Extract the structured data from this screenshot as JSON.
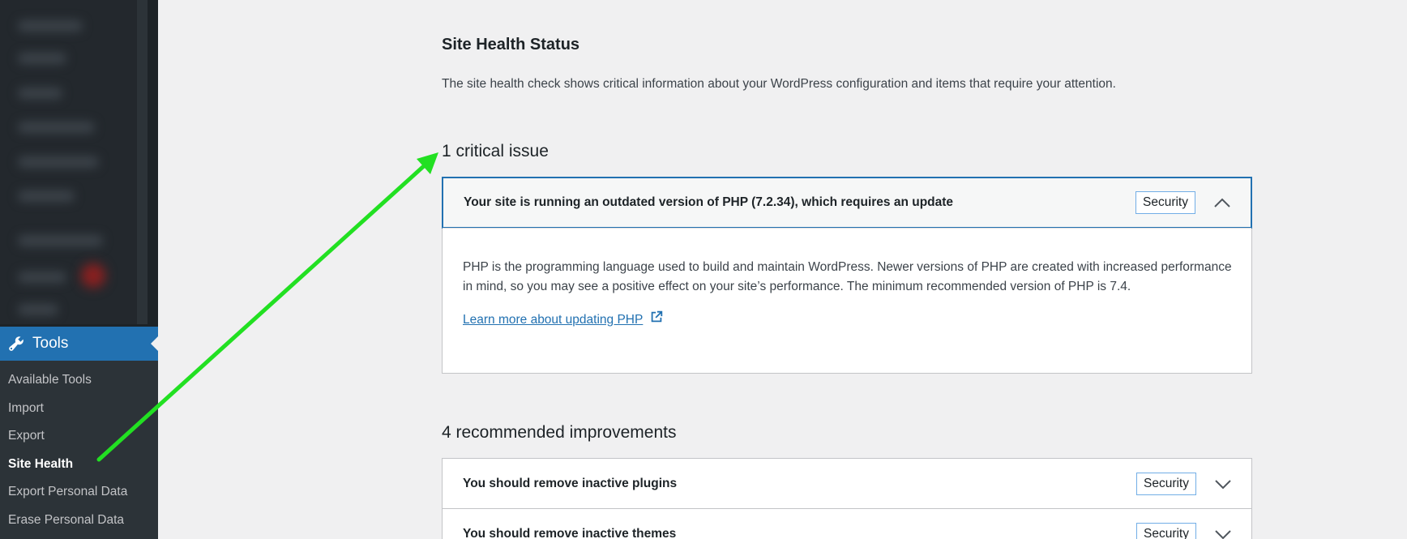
{
  "sidebar": {
    "tools_label": "Tools",
    "submenu": [
      {
        "label": "Available Tools",
        "current": false
      },
      {
        "label": "Import",
        "current": false
      },
      {
        "label": "Export",
        "current": false
      },
      {
        "label": "Site Health",
        "current": true
      },
      {
        "label": "Export Personal Data",
        "current": false
      },
      {
        "label": "Erase Personal Data",
        "current": false
      }
    ]
  },
  "page": {
    "title": "Site Health Status",
    "description": "The site health check shows critical information about your WordPress configuration and items that require your attention."
  },
  "critical": {
    "heading": "1 critical issue",
    "items": [
      {
        "title": "Your site is running an outdated version of PHP (7.2.34), which requires an update",
        "badge": "Security",
        "body": "PHP is the programming language used to build and maintain WordPress. Newer versions of PHP are created with increased performance in mind, so you may see a positive effect on your site’s performance. The minimum recommended version of PHP is 7.4.",
        "link": "Learn more about updating PHP"
      }
    ]
  },
  "recommended": {
    "heading": "4 recommended improvements",
    "items": [
      {
        "title": "You should remove inactive plugins",
        "badge": "Security"
      },
      {
        "title": "You should remove inactive themes",
        "badge": "Security"
      }
    ]
  },
  "colors": {
    "accent": "#2271b1",
    "sidebar": "#1d2327",
    "annotation_arrow": "#22e022"
  },
  "icons": {
    "tools": "wrench-icon",
    "expanded": "chevron-up-icon",
    "collapsed": "chevron-down-icon",
    "external": "external-link-icon"
  }
}
